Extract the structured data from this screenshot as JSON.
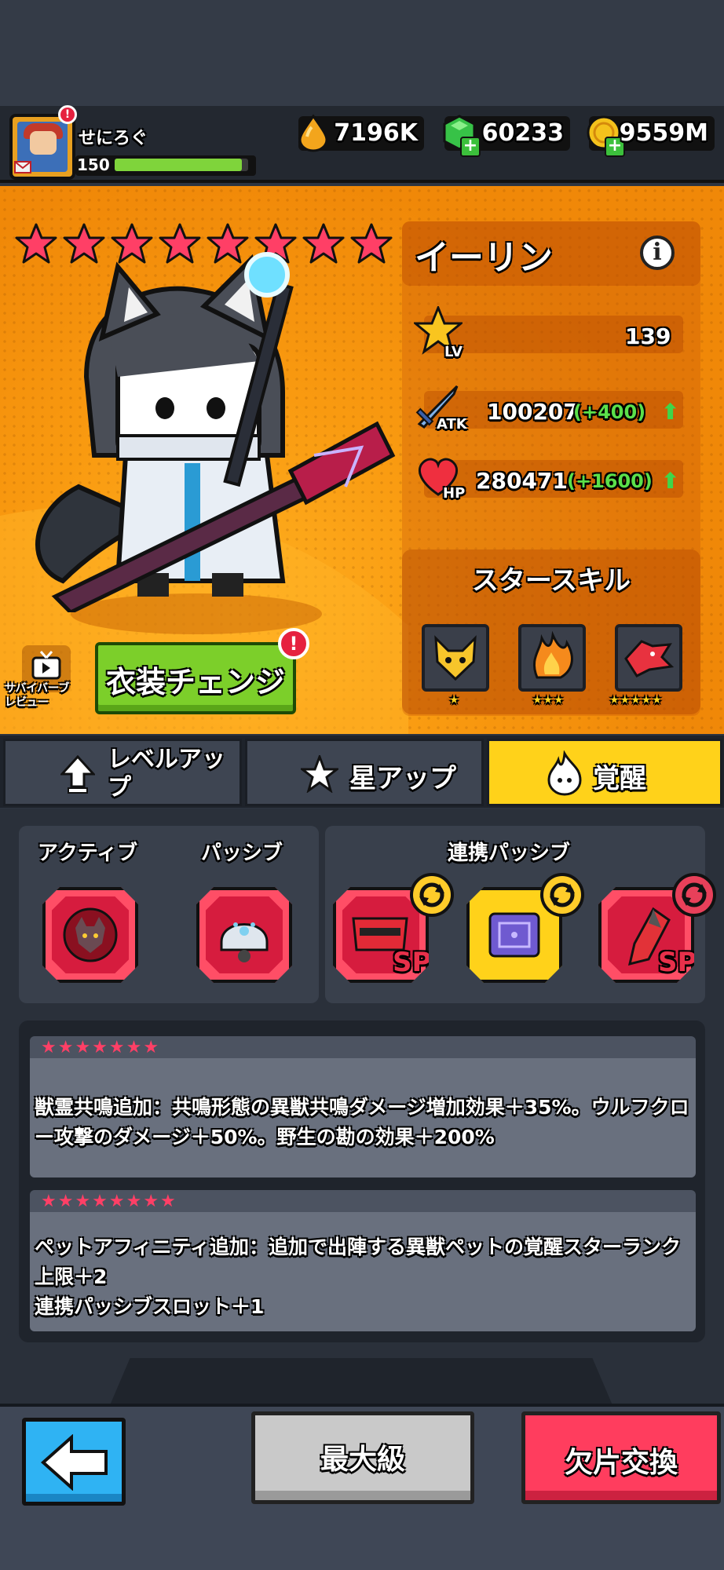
{
  "player": {
    "name": "せにろぐ",
    "level": "150",
    "exp_fraction": 0.95,
    "notification": "!"
  },
  "currencies": [
    {
      "name": "drop",
      "value": "7196K",
      "icon": "oil-drop-icon",
      "color": "#f3a51c"
    },
    {
      "name": "gems",
      "value": "60233",
      "icon": "green-gem-icon",
      "color": "#37c247"
    },
    {
      "name": "coins",
      "value": "9559M",
      "icon": "gold-coin-icon",
      "color": "#f4c21c"
    }
  ],
  "hero": {
    "name": "イーリン",
    "star_count": 8,
    "level_label": "LV",
    "level": "139",
    "atk_label": "ATK",
    "atk": "100207",
    "atk_inc": "(+400)",
    "hp_label": "HP",
    "hp": "280471",
    "hp_inc": "(+1600)"
  },
  "star_skill": {
    "title": "スタースキル",
    "slots": [
      {
        "icon": "fox-head-icon",
        "stars": "★"
      },
      {
        "icon": "flame-claw-icon",
        "stars": "★★★"
      },
      {
        "icon": "red-wolf-icon",
        "stars": "★★★★★"
      }
    ]
  },
  "review": {
    "label": "サバイバーブ\nレビュー"
  },
  "costume": {
    "label": "衣装チェンジ",
    "badge": "!"
  },
  "tabs": [
    {
      "label": "レベルアッ\nプ",
      "icon": "up-arrow-icon"
    },
    {
      "label": "星アップ",
      "icon": "star-icon"
    },
    {
      "label": "覚醒",
      "icon": "awaken-flame-icon"
    }
  ],
  "skills": {
    "active_label": "アクティブ",
    "passive_label": "パッシブ",
    "linked_label": "連携パッシブ",
    "sp": "SP"
  },
  "awakenings": [
    {
      "stars": "★★★★★★★",
      "text": "獣霊共鳴追加：共鳴形態の異獣共鳴ダメージ増加効果＋35%。ウルフクロー攻撃のダメージ＋50%。野生の勘の効果＋200%"
    },
    {
      "stars": "★★★★★★★★",
      "text": "ペットアフィニティ追加：追加で出陣する異獣ペットの覚醒スターランク上限＋2\n連携パッシブスロット＋1"
    }
  ],
  "bottom": {
    "max_label": "最大級",
    "exchange_label": "欠片交換"
  },
  "colors": {
    "star_pink": "#ff3f66",
    "accent_yellow": "#ffd21a",
    "increase_green": "#5be04a",
    "panel_orange": "#f99a10"
  }
}
